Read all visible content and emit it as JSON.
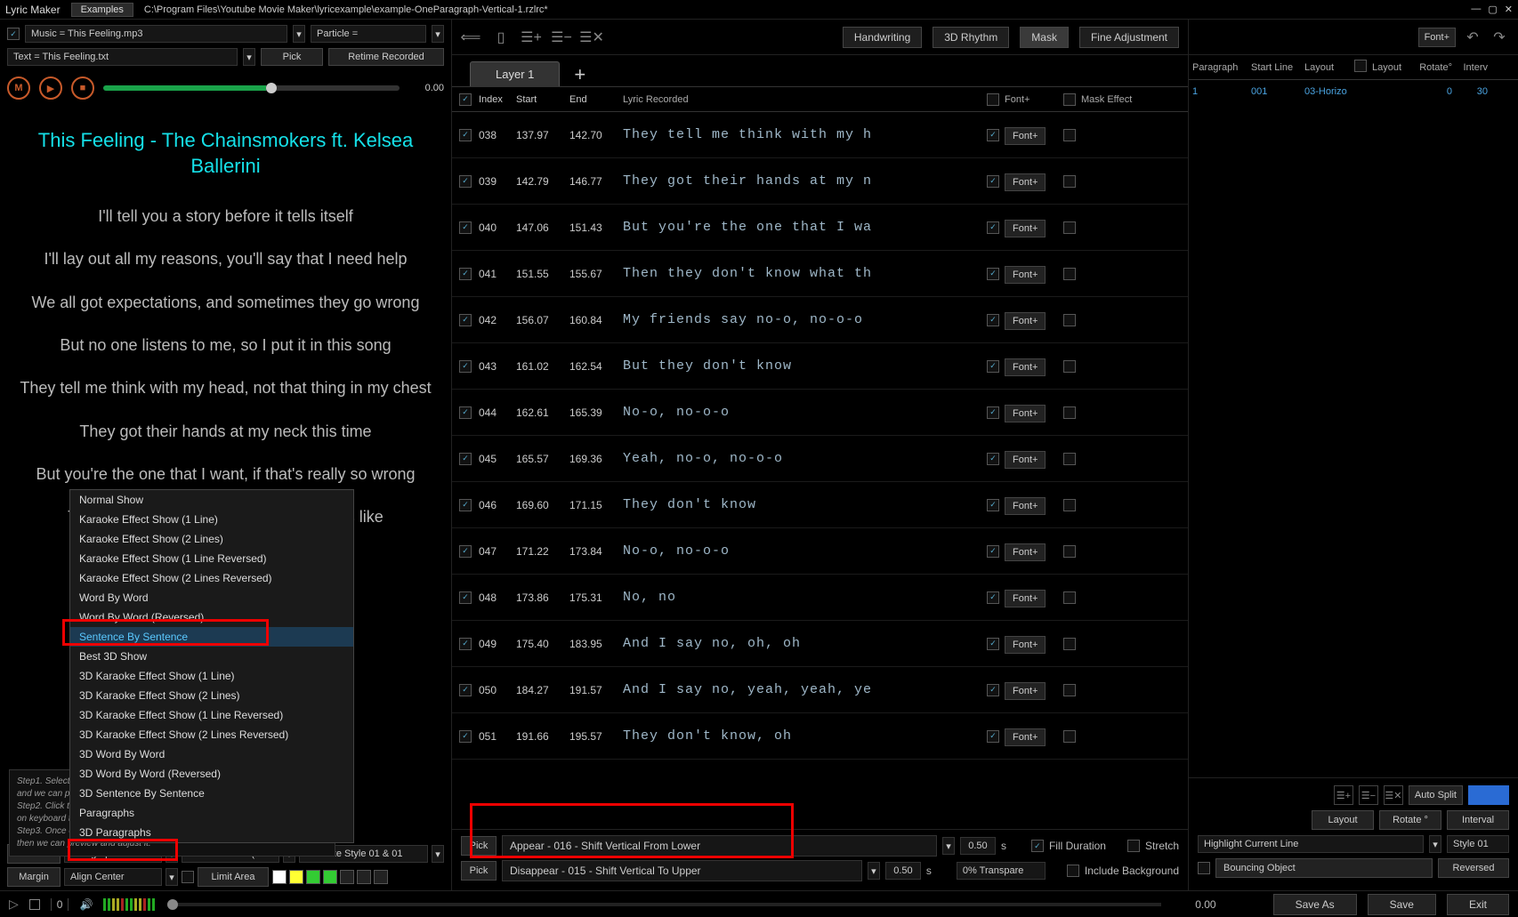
{
  "titlebar": {
    "app_name": "Lyric Maker",
    "examples_btn": "Examples",
    "file_path": "C:\\Program Files\\Youtube Movie Maker\\lyricexample\\example-OneParagraph-Vertical-1.rzlrc*"
  },
  "left": {
    "music_field": "Music = This Feeling.mp3",
    "particle_field": "Particle =",
    "text_field": "Text = This Feeling.txt",
    "pick_btn": "Pick",
    "retime_btn": "Retime Recorded",
    "transport_time": "0.00",
    "preview_title": "This Feeling - The Chainsmokers ft. Kelsea Ballerini",
    "preview_lines": [
      "I'll tell you a story before it tells itself",
      "I'll lay out all my reasons, you'll say that I need help",
      "We all got expectations, and sometimes they go wrong",
      "But no one listens to me, so I put it in this song",
      "They tell me think with my head, not that thing in my chest",
      "They got their hands at my neck this time",
      "But you're the one that I want, if that's really so wrong",
      "Then they don't know what this feeling is like"
    ],
    "context_menu": [
      "Normal Show",
      "Karaoke Effect Show (1 Line)",
      "Karaoke Effect Show (2 Lines)",
      "Karaoke Effect Show (1 Line Reversed)",
      "Karaoke Effect Show (2 Lines Reversed)",
      "Word By Word",
      "Word By Word (Reversed)",
      "Sentence By Sentence",
      "Best 3D Show",
      "3D Karaoke Effect Show (1 Line)",
      "3D Karaoke Effect Show (2 Lines)",
      "3D Karaoke Effect Show (1 Line Reversed)",
      "3D Karaoke Effect Show (2 Lines Reversed)",
      "3D Word By Word",
      "3D Word By Word (Reversed)",
      "3D Sentence By Sentence",
      "Paragraphs",
      "3D Paragraphs"
    ],
    "context_selected_index": 7,
    "steps_text": "Step1. Select the Lyric text file, then player below will display all Lyrics text, and we can preview it.\nStep2. Click the \"Retime Recorded\" button to play music, then press any key on keyboard to record a lyric until the music end.\nStep3. Once completed, player below will play music with the recorded lyrics, then we can preview and adjust it.",
    "bottom": {
      "font_btn": "Font",
      "paragraphs_field": "Paragraphs",
      "resolution_field": "SD 480P 16:9 (I",
      "karaoke_style_field": "Karaoke Style 01 & 01",
      "margin_btn": "Margin",
      "align_field": "Align Center",
      "limit_area_btn": "Limit Area",
      "swatches": [
        "#ffffff",
        "#ffff33",
        "#33cc33",
        "#33cc33",
        "#222222",
        "#222222",
        "#222222"
      ]
    }
  },
  "center": {
    "modes": {
      "handwriting": "Handwriting",
      "rhythm": "3D Rhythm",
      "mask": "Mask",
      "fine": "Fine Adjustment"
    },
    "active_mode": "mask",
    "layer_tab": "Layer 1",
    "headers": {
      "index": "Index",
      "start": "Start",
      "end": "End",
      "lyric": "Lyric Recorded",
      "font": "Font+",
      "mask": "Mask Effect"
    },
    "rows": [
      {
        "idx": "038",
        "start": "137.97",
        "end": "142.70",
        "lyric": "They tell me think with my h"
      },
      {
        "idx": "039",
        "start": "142.79",
        "end": "146.77",
        "lyric": "They got their hands at my n"
      },
      {
        "idx": "040",
        "start": "147.06",
        "end": "151.43",
        "lyric": "But you're the one that I wa"
      },
      {
        "idx": "041",
        "start": "151.55",
        "end": "155.67",
        "lyric": "Then they don't know what th"
      },
      {
        "idx": "042",
        "start": "156.07",
        "end": "160.84",
        "lyric": "My friends say no-o, no-o-o"
      },
      {
        "idx": "043",
        "start": "161.02",
        "end": "162.54",
        "lyric": "But they don't know"
      },
      {
        "idx": "044",
        "start": "162.61",
        "end": "165.39",
        "lyric": "No-o, no-o-o"
      },
      {
        "idx": "045",
        "start": "165.57",
        "end": "169.36",
        "lyric": "Yeah, no-o, no-o-o"
      },
      {
        "idx": "046",
        "start": "169.60",
        "end": "171.15",
        "lyric": "They don't know"
      },
      {
        "idx": "047",
        "start": "171.22",
        "end": "173.84",
        "lyric": "No-o, no-o-o"
      },
      {
        "idx": "048",
        "start": "173.86",
        "end": "175.31",
        "lyric": "No, no"
      },
      {
        "idx": "049",
        "start": "175.40",
        "end": "183.95",
        "lyric": "And I say no, oh, oh"
      },
      {
        "idx": "050",
        "start": "184.27",
        "end": "191.57",
        "lyric": "And I say no, yeah, yeah, ye"
      },
      {
        "idx": "051",
        "start": "191.66",
        "end": "195.57",
        "lyric": "They don't know, oh"
      }
    ],
    "font_btn_label": "Font+",
    "bottom": {
      "pick_label": "Pick",
      "appear_field": "Appear - 016 - Shift Vertical From Lower",
      "disappear_field": "Disappear - 015 - Shift Vertical To Upper",
      "duration_val": "0.50",
      "duration_unit": "s",
      "fill_duration": "Fill Duration",
      "stretch": "Stretch",
      "transparent": "0% Transpare",
      "include_bg": "Include Background"
    }
  },
  "right": {
    "font_btn": "Font+",
    "headers": {
      "para": "Paragraph",
      "start": "Start Line",
      "layout": "Layout",
      "layout2": "Layout",
      "rotate": "Rotate°",
      "interval": "Interv"
    },
    "row": {
      "para": "1",
      "start": "001",
      "layout": "03-Horizo",
      "rotate": "0",
      "interval": "30"
    },
    "bottom": {
      "auto_split": "Auto Split",
      "layout_btn": "Layout",
      "rotate_btn": "Rotate °",
      "interval_btn": "Interval",
      "highlight": "Highlight Current Line",
      "style": "Style 01",
      "bouncing": "Bouncing Object",
      "reversed": "Reversed"
    }
  },
  "statusbar": {
    "zero": "0",
    "time": "0.00",
    "save_as": "Save As",
    "save": "Save",
    "exit": "Exit"
  }
}
